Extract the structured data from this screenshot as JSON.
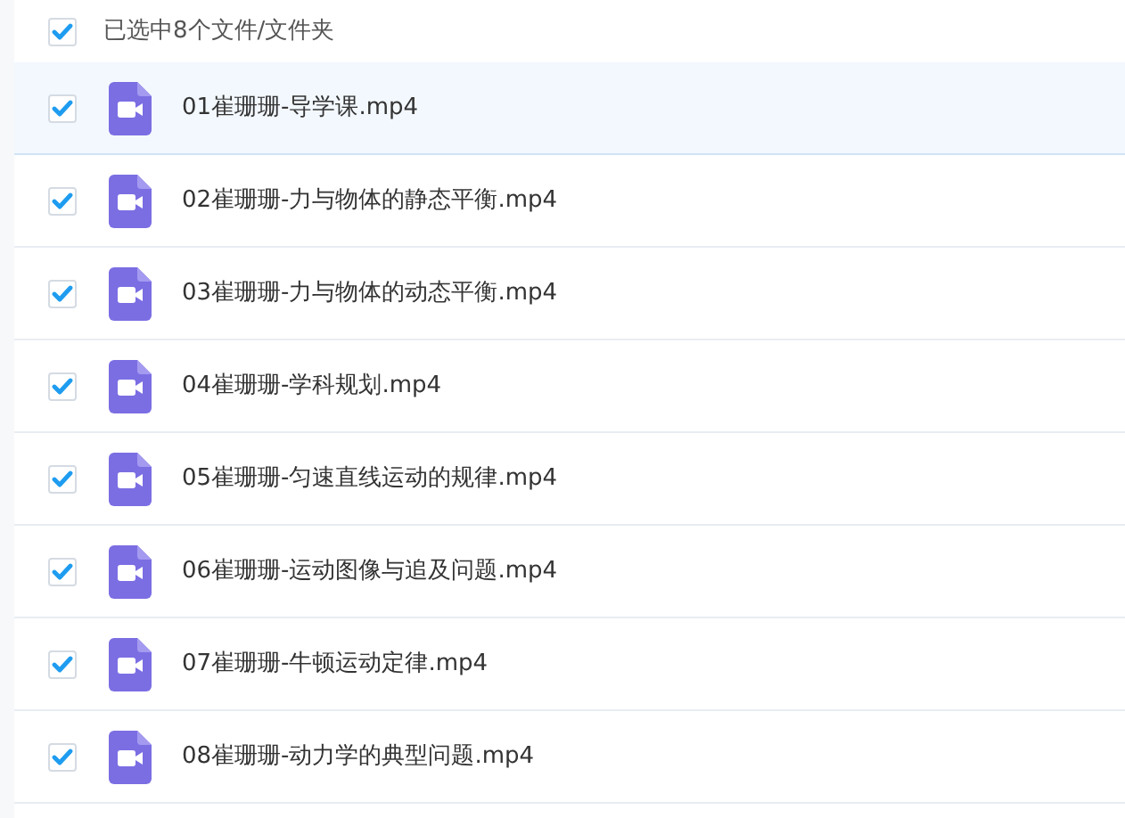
{
  "header": {
    "checked": true,
    "label": "已选中8个文件/文件夹"
  },
  "files": [
    {
      "name": "01崔珊珊-导学课.mp4",
      "checked": true,
      "hovered": true
    },
    {
      "name": "02崔珊珊-力与物体的静态平衡.mp4",
      "checked": true,
      "hovered": false
    },
    {
      "name": "03崔珊珊-力与物体的动态平衡.mp4",
      "checked": true,
      "hovered": false
    },
    {
      "name": "04崔珊珊-学科规划.mp4",
      "checked": true,
      "hovered": false
    },
    {
      "name": "05崔珊珊-匀速直线运动的规律.mp4",
      "checked": true,
      "hovered": false
    },
    {
      "name": "06崔珊珊-运动图像与追及问题.mp4",
      "checked": true,
      "hovered": false
    },
    {
      "name": "07崔珊珊-牛顿运动定律.mp4",
      "checked": true,
      "hovered": false
    },
    {
      "name": "08崔珊珊-动力学的典型问题.mp4",
      "checked": true,
      "hovered": false
    }
  ]
}
